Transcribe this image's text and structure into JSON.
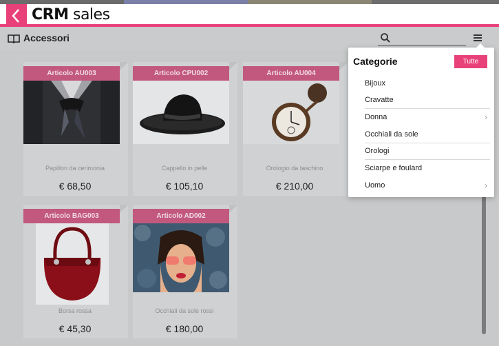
{
  "app": {
    "title_bold": "CRM",
    "title_light": "sales"
  },
  "section": {
    "title": "Accessori"
  },
  "search": {
    "value": "",
    "placeholder": ""
  },
  "products": [
    {
      "code": "Articolo AU003",
      "name": "Papillon da cerimonia",
      "price": "€ 68,50"
    },
    {
      "code": "Articolo CPU002",
      "name": "Cappello in pelle",
      "price": "€ 105,10"
    },
    {
      "code": "Articolo AU004",
      "name": "Orologio da taschino",
      "price": "€ 210,00"
    },
    {
      "code": "Articolo BAG003",
      "name": "Borsa rossa",
      "price": "€ 45,30"
    },
    {
      "code": "Articolo AD002",
      "name": "Occhiali da sole rossi",
      "price": "€ 180,00"
    }
  ],
  "categories_popup": {
    "title": "Categorie",
    "all_label": "Tutte",
    "items": [
      {
        "label": "Bijoux",
        "has_children": false
      },
      {
        "label": "Cravatte",
        "has_children": false
      },
      {
        "label": "Donna",
        "has_children": true
      },
      {
        "label": "Occhiali da sole",
        "has_children": false
      },
      {
        "label": "Orologi",
        "has_children": false
      },
      {
        "label": "Sciarpe e foulard",
        "has_children": false
      },
      {
        "label": "Uomo",
        "has_children": true
      }
    ]
  },
  "colors": {
    "accent": "#e8417a",
    "tag": "#c2587e",
    "background": "#c7c9ca"
  }
}
